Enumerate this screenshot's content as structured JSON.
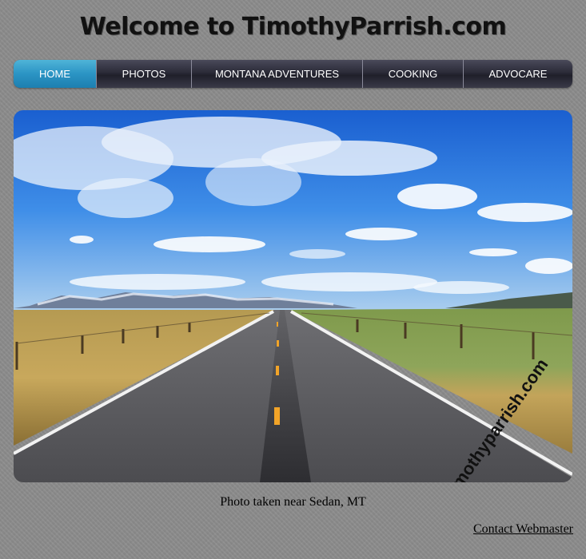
{
  "header": {
    "title": "Welcome to TimothyParrish.com"
  },
  "nav": {
    "items": [
      {
        "label": "HOME",
        "active": true
      },
      {
        "label": "PHOTOS",
        "active": false
      },
      {
        "label": "MONTANA ADVENTURES",
        "active": false
      },
      {
        "label": "COOKING",
        "active": false
      },
      {
        "label": "ADVOCARE",
        "active": false
      }
    ]
  },
  "hero": {
    "watermark": "timothyparrish.com",
    "caption": "Photo taken near Sedan, MT"
  },
  "footer": {
    "contact_label": "Contact Webmaster"
  },
  "colors": {
    "nav_active": "#2b94c4",
    "nav_bg": "#2b2b38",
    "page_bg": "#8c8c8c"
  }
}
